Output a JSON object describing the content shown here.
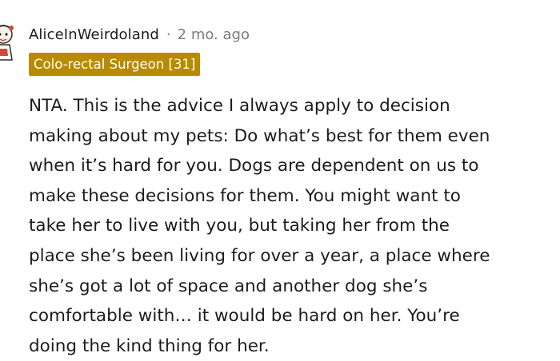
{
  "comment": {
    "author": "AliceInWeirdoland",
    "separator": "·",
    "age": "2 mo. ago",
    "flair": "Colo-rectal Surgeon [31]",
    "lines": [
      "NTA. This is the advice I always apply to decision",
      "making about my pets: Do what’s best for them even",
      "when it’s hard for you. Dogs are dependent on us to",
      "make these decisions for them. You might want to",
      "take her to live with you, but taking her from the",
      "place she’s been living for over a year, a place where",
      "she’s got a lot of space and another dog she’s",
      "comfortable with… it would be hard on her. You’re",
      "doing the kind thing for her."
    ]
  },
  "colors": {
    "flair_background": "#b88a00",
    "text": "#1c1c1c",
    "meta": "#7c7c7c"
  }
}
